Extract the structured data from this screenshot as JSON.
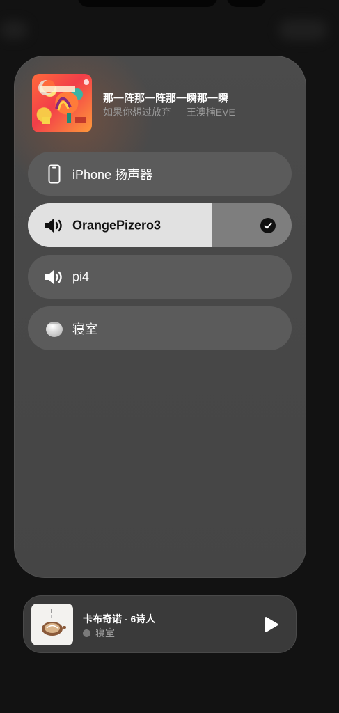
{
  "now_playing": {
    "title": "那一阵那一阵那一瞬那一瞬",
    "subtitle": "如果你想过放弃 — 王澳楠EVE"
  },
  "devices": [
    {
      "label": "iPhone 扬声器",
      "icon": "iphone-icon",
      "selected": false
    },
    {
      "label": "OrangePizero3",
      "icon": "speaker-icon",
      "selected": true,
      "volume": 0.7
    },
    {
      "label": "pi4",
      "icon": "speaker-icon",
      "selected": false
    },
    {
      "label": "寝室",
      "icon": "homepod-mini-icon",
      "selected": false
    }
  ],
  "mini_player": {
    "title": "卡布奇诺 - 6诗人",
    "room": "寝室",
    "play_icon": "play-icon"
  },
  "colors": {
    "panel": "#484848",
    "device_row": "#5b5b5b",
    "selected_fill": "#e1e1e1",
    "background": "#121212"
  }
}
